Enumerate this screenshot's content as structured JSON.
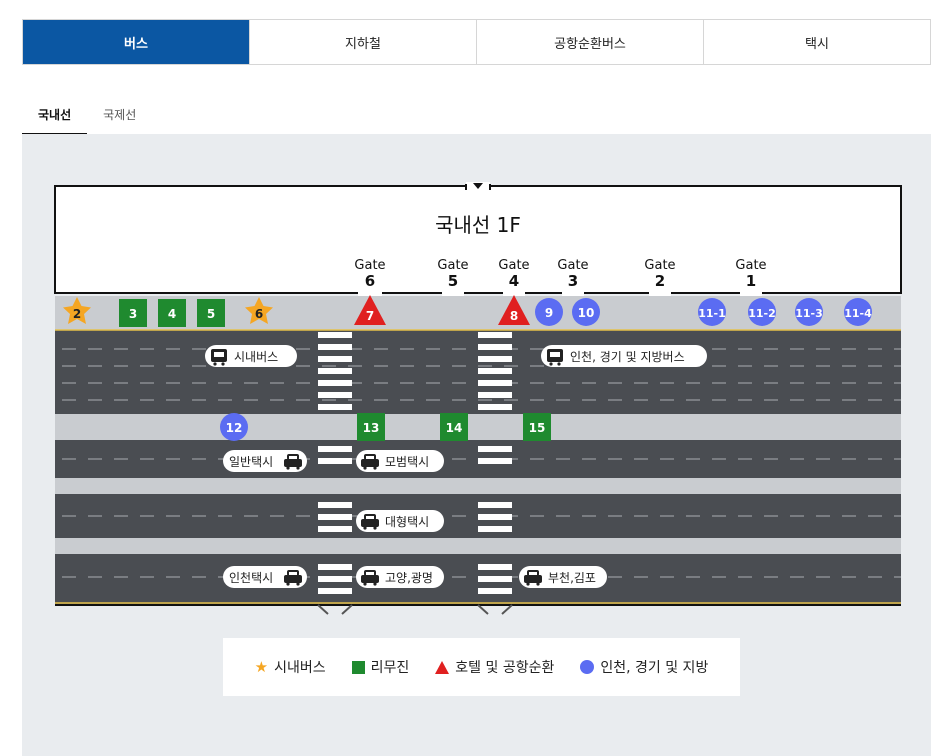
{
  "tabs": [
    {
      "label": "버스",
      "active": true
    },
    {
      "label": "지하철",
      "active": false
    },
    {
      "label": "공항순환버스",
      "active": false
    },
    {
      "label": "택시",
      "active": false
    }
  ],
  "subtabs": [
    {
      "label": "국내선",
      "active": true
    },
    {
      "label": "국제선",
      "active": false
    }
  ],
  "map": {
    "terminal_title": "국내선 1F",
    "gate_word": "Gate",
    "gates": [
      "6",
      "5",
      "4",
      "3",
      "2",
      "1"
    ],
    "stops": {
      "stars": [
        "2",
        "6"
      ],
      "squares": [
        "3",
        "4",
        "5",
        "13",
        "14",
        "15"
      ],
      "triangles": [
        "7",
        "8"
      ],
      "circles": [
        "9",
        "10",
        "11-1",
        "11-2",
        "11-3",
        "11-4",
        "12"
      ]
    },
    "road_labels": {
      "city_bus": "시내버스",
      "incheon_bus": "인천, 경기 및 지방버스",
      "regular_taxi": "일반택시",
      "deluxe_taxi": "모범택시",
      "large_taxi": "대형택시",
      "incheon_taxi": "인천택시",
      "goyang_taxi": "고양,광명",
      "bucheon_taxi": "부천,김포"
    }
  },
  "legend": [
    {
      "symbol": "star",
      "label": "시내버스"
    },
    {
      "symbol": "square",
      "label": "리무진"
    },
    {
      "symbol": "triangle",
      "label": "호텔 및 공항순환"
    },
    {
      "symbol": "circle",
      "label": "인천, 경기 및 지방"
    }
  ],
  "colors": {
    "active_tab": "#0b57a3",
    "star": "#f5a623",
    "square": "#1f8a2f",
    "triangle": "#e02020",
    "circle": "#5b6cf2",
    "road": "#4a4d52",
    "sidewalk": "#c9ccd0"
  }
}
